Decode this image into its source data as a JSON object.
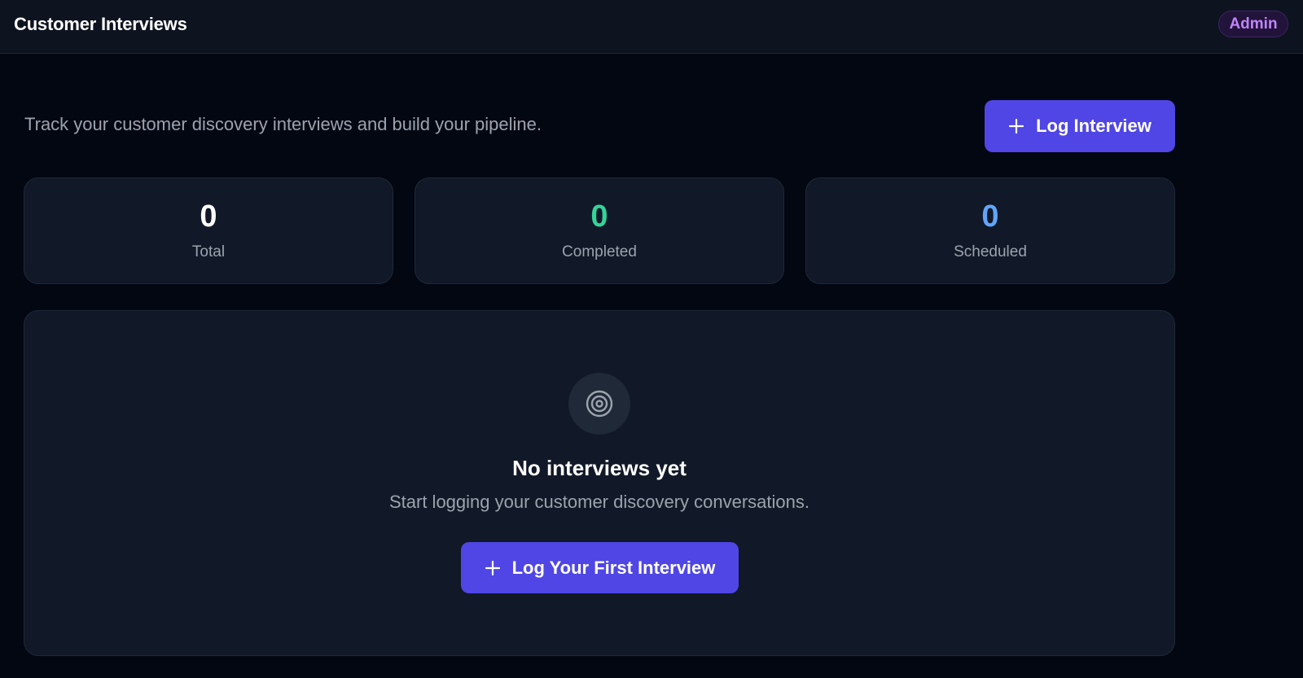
{
  "header": {
    "title": "Customer Interviews",
    "role_badge": "Admin"
  },
  "intro": {
    "subtitle": "Track your customer discovery interviews and build your pipeline.",
    "log_button_label": "Log Interview",
    "log_button_icon": "plus-icon"
  },
  "stats": [
    {
      "value": "0",
      "label": "Total",
      "color": "#ffffff"
    },
    {
      "value": "0",
      "label": "Completed",
      "color": "#34d399"
    },
    {
      "value": "0",
      "label": "Scheduled",
      "color": "#60a5fa"
    }
  ],
  "empty_state": {
    "icon": "target-icon",
    "title": "No interviews yet",
    "description": "Start logging your customer discovery conversations.",
    "button_label": "Log Your First Interview",
    "button_icon": "plus-icon"
  },
  "colors": {
    "accent": "#4f46e5",
    "badge_text": "#c084fc",
    "background": "#030712",
    "card": "#111827"
  }
}
